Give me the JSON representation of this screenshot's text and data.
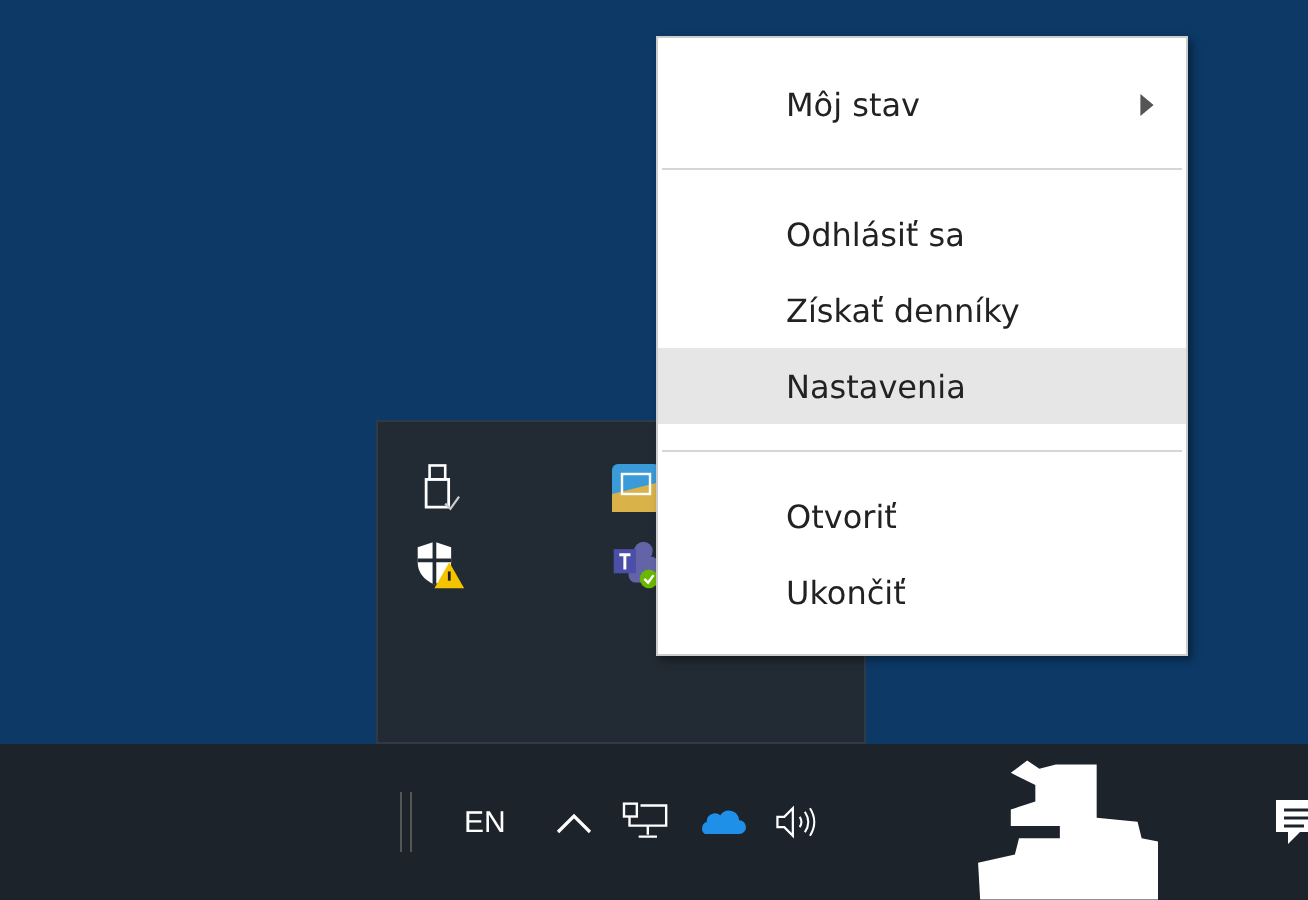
{
  "context_menu": {
    "items": [
      {
        "kind": "submenu",
        "label": "Môj stav",
        "selected": false
      },
      {
        "kind": "separator"
      },
      {
        "kind": "item",
        "label": "Odhlásiť sa",
        "selected": false
      },
      {
        "kind": "item",
        "label": "Získať denníky",
        "selected": false
      },
      {
        "kind": "item",
        "label": "Nastavenia",
        "selected": true
      },
      {
        "kind": "separator"
      },
      {
        "kind": "item",
        "label": "Otvoriť",
        "selected": false
      },
      {
        "kind": "item",
        "label": "Ukončiť",
        "selected": false
      }
    ]
  },
  "taskbar": {
    "language": "EN"
  }
}
